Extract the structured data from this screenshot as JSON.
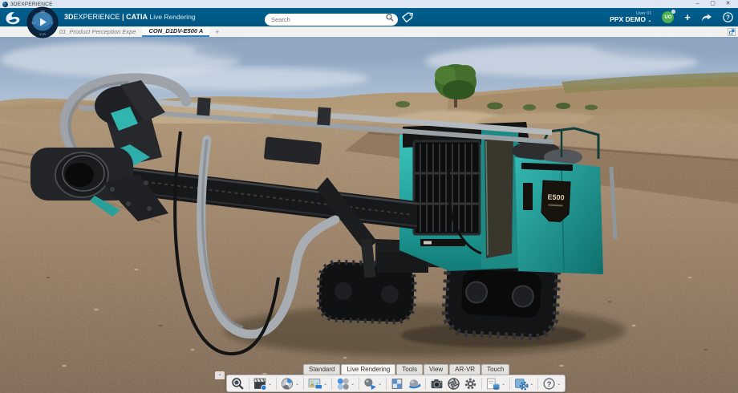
{
  "window": {
    "title": "3DEXPERIENCE",
    "controls": {
      "minimize": "–",
      "maximize": "▢",
      "close": "✕"
    }
  },
  "app_bar": {
    "brand_bold": "3D",
    "brand_regular": "EXPERIENCE",
    "separator": "|",
    "app_name": "CATIA",
    "app_mode": "Live Rendering",
    "search": {
      "placeholder": "Search"
    },
    "user": {
      "role_label": "User 01",
      "account": "PPX DEMO",
      "caret": "⌄",
      "avatar_initials": "UO"
    },
    "actions": {
      "add": "+",
      "help": "?"
    }
  },
  "tab_bar": {
    "tabs": [
      {
        "label": "01_Product Perception Expe",
        "active": false
      },
      {
        "label": "CON_D1DV-E500 A",
        "active": true
      }
    ],
    "add_label": "+"
  },
  "viewport": {
    "machine_badge": "E500",
    "scene": "teal crawler drilling rig in gravel quarry, cloudy sky, tree on horizon"
  },
  "bottom_toolbar": {
    "collapse": "⌄",
    "tabs": [
      {
        "label": "Standard",
        "active": false
      },
      {
        "label": "Live Rendering",
        "active": true
      },
      {
        "label": "Tools",
        "active": false
      },
      {
        "label": "View",
        "active": false
      },
      {
        "label": "AR-VR",
        "active": false
      },
      {
        "label": "Touch",
        "active": false
      }
    ],
    "icons": [
      {
        "name": "zoom-magnifier",
        "dropdown": false
      },
      {
        "name": "animation-clapperboard",
        "dropdown": true
      },
      {
        "name": "render-disc",
        "dropdown": true
      },
      {
        "name": "environment-image",
        "dropdown": true
      },
      {
        "name": "material-spheres",
        "dropdown": true
      },
      {
        "name": "shader-sphere",
        "dropdown": true
      },
      {
        "name": "texture-cube",
        "dropdown": false
      },
      {
        "name": "turntable-sphere",
        "dropdown": false
      },
      {
        "name": "camera",
        "dropdown": false
      },
      {
        "name": "aperture",
        "dropdown": false
      },
      {
        "name": "gear",
        "dropdown": false
      },
      {
        "name": "data-export",
        "dropdown": true
      },
      {
        "name": "settings-gear",
        "dropdown": true
      },
      {
        "name": "help",
        "dropdown": true
      }
    ],
    "caret": "⌄",
    "help_glyph": "?"
  },
  "colors": {
    "appbar_blue": "#005380",
    "tab_accent_blue": "#2f80c8",
    "machine_teal": "#2fb7b2",
    "avatar_green": "#4caf50"
  }
}
